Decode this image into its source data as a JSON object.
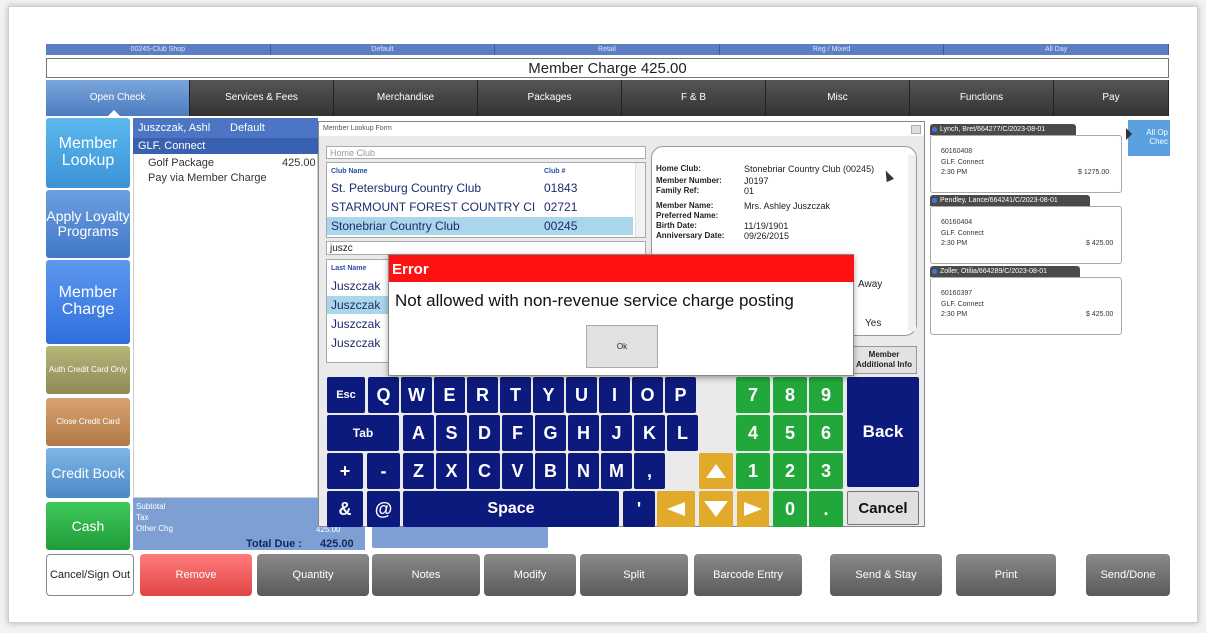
{
  "context_bar": [
    "00245-Club Shop",
    "Default",
    "Retail",
    "Reg / Mixed",
    "All Day"
  ],
  "title": "Member Charge 425.00",
  "tabs": [
    "Open Check",
    "Services & Fees",
    "Merchandise",
    "Packages",
    "F & B",
    "Misc",
    "Functions",
    "Pay"
  ],
  "left_buttons": {
    "member_lookup": "Member Lookup",
    "apply_loyalty": "Apply Loyalty Programs",
    "member_charge": "Member Charge",
    "auth_credit": "Auth Credit Card Only",
    "close_credit": "Close Credit Card",
    "credit_book": "Credit Book",
    "cash": "Cash"
  },
  "order": {
    "name": "Juszczak, Ashl",
    "profile": "Default",
    "group": "GLF. Connect",
    "item": "Golf Package",
    "item_price": "425.00",
    "pay": "Pay via Member Charge",
    "subtotal_label": "Subtotal",
    "tax_label": "Tax",
    "other_label": "Other Chg",
    "other_value": "425.00",
    "total_label": "Total Due :",
    "total_value": "425.00"
  },
  "dialog": {
    "title": "Member Lookup Form",
    "home_club_placeholder": "Home Club",
    "club_headers": [
      "Club Name",
      "Club #"
    ],
    "clubs": [
      {
        "name": "St. Petersburg Country Club",
        "num": "01843"
      },
      {
        "name": "STARMOUNT FOREST COUNTRY CI",
        "num": "02721"
      },
      {
        "name": "Stonebriar Country Club",
        "num": "00245"
      }
    ],
    "search": "juszc",
    "last_name_header": "Last Name",
    "last_names": [
      "Juszczak",
      "Juszczak",
      "Juszczak",
      "Juszczak"
    ],
    "details": [
      {
        "k": "Home Club:",
        "v": "Stonebriar Country Club (00245)"
      },
      {
        "k": "Member Number:",
        "v": "J0197"
      },
      {
        "k": "Family Ref:",
        "v": "01"
      },
      {
        "k": "Member Name:",
        "v": "Mrs. Ashley Juszczak"
      },
      {
        "k": "Preferred Name:",
        "v": ""
      },
      {
        "k": "Birth Date:",
        "v": "11/19/1901"
      },
      {
        "k": "Anniversary Date:",
        "v": "09/26/2015"
      }
    ],
    "away": "Away",
    "yes": "Yes",
    "member_info": "Member Additional Info"
  },
  "error": {
    "title": "Error",
    "message": "Not allowed with non-revenue service charge posting",
    "ok": "Ok"
  },
  "keyboard": {
    "esc": "Esc",
    "tab": "Tab",
    "space": "Space",
    "back": "Back",
    "cancel": "Cancel",
    "row1": [
      "Q",
      "W",
      "E",
      "R",
      "T",
      "Y",
      "U",
      "I",
      "O",
      "P"
    ],
    "row2": [
      "A",
      "S",
      "D",
      "F",
      "G",
      "H",
      "J",
      "K",
      "L"
    ],
    "row3": [
      "Z",
      "X",
      "C",
      "V",
      "B",
      "N",
      "M",
      ","
    ],
    "sym": [
      "+",
      "-",
      "&",
      "@",
      "'"
    ],
    "nums": [
      "7",
      "8",
      "9",
      "4",
      "5",
      "6",
      "1",
      "2",
      "3",
      "0",
      "."
    ]
  },
  "appointments": [
    {
      "header": "Lynch, Bret/664277/C/2023-08-01",
      "code": "60160408",
      "group": "GLF. Connect",
      "time": "2:30 PM",
      "amount": "$ 1275.00"
    },
    {
      "header": "Pendley, Lance/664241/C/2023-08-01",
      "code": "60160404",
      "group": "GLF. Connect",
      "time": "2:30 PM",
      "amount": "$ 425.00"
    },
    {
      "header": "Zoller, Otilia/664289/C/2023-08-01",
      "code": "60160397",
      "group": "GLF. Connect",
      "time": "2:30 PM",
      "amount": "$ 425.00"
    }
  ],
  "all_open": "All Op Chec",
  "bottom": [
    "Cancel/Sign Out",
    "Remove",
    "Quantity",
    "Notes",
    "Modify",
    "Split",
    "Barcode Entry",
    "Send & Stay",
    "Print",
    "Send/Done"
  ]
}
